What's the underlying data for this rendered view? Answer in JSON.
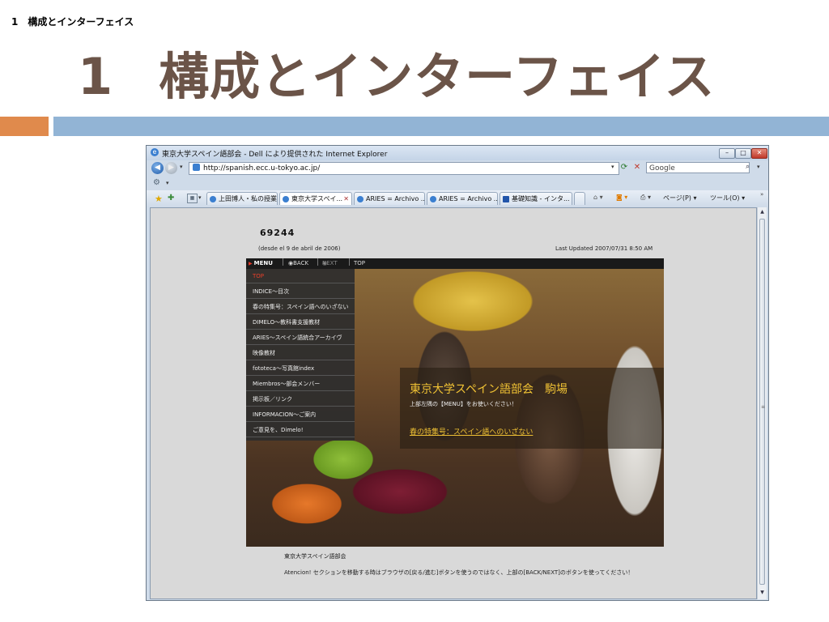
{
  "slide": {
    "header": "1　構成とインターフェイス",
    "title_num": "1",
    "title_text": "構成とインターフェイス"
  },
  "browser": {
    "window_title": "東京大学スペイン語部会 - Dell により提供された Internet Explorer",
    "url": "http://spanish.ecc.u-tokyo.ac.jp/",
    "search_placeholder": "Google",
    "tabs": [
      {
        "label": "上田博人・私の授業"
      },
      {
        "label": "東京大学スペイ..."
      },
      {
        "label": "ARIES = Archivo ..."
      },
      {
        "label": "ARIES = Archivo ..."
      },
      {
        "label": "基礎知識 - インタ..."
      }
    ],
    "commands": {
      "page": "ページ(P) ▾",
      "tools": "ツール(O) ▾"
    }
  },
  "page": {
    "counter": "69244",
    "since": "(desde el 9 de abril de 2006)",
    "last_updated": "Last Updated 2007/07/31 8:50 AM",
    "nav": {
      "menu": "MENU",
      "back": "BACK",
      "next": "NEXT",
      "top": "TOP"
    },
    "menu_items": [
      {
        "label": "TOP"
      },
      {
        "label": "INDICE〜目次"
      },
      {
        "label": "春の特集号：スペイン語へのいざない"
      },
      {
        "label": "DIMELO〜教科書支援教材"
      },
      {
        "label": "ARIES〜スペイン語統合アーカイヴ"
      },
      {
        "label": "映像教材"
      },
      {
        "label": "fototeca〜写真館index"
      },
      {
        "label": "Miembros〜部会メンバー"
      },
      {
        "label": "掲示板／リンク"
      },
      {
        "label": "INFORMACION〜ご案内"
      },
      {
        "label": "ご意見を、Dimelo!"
      }
    ],
    "welcome": {
      "title": "東京大学スペイン語部会　駒場",
      "subtitle": "上部左隅の【MENU】をお使いください！",
      "link": "春の特集号：スペイン語へのいざない"
    },
    "footer_name": "東京大学スペイン語部会",
    "footer_note": "Atencion! セクションを移動する時はブラウザの[戻る/進む]ボタンを使うのではなく、上部の[BACK/NEXT]のボタンを使ってください！"
  },
  "colors": {
    "title": "#6b5448",
    "accent_orange": "#e08a4c",
    "accent_blue": "#92b4d5",
    "menu_active": "#e8402a",
    "welcome_gold": "#f0c234"
  }
}
